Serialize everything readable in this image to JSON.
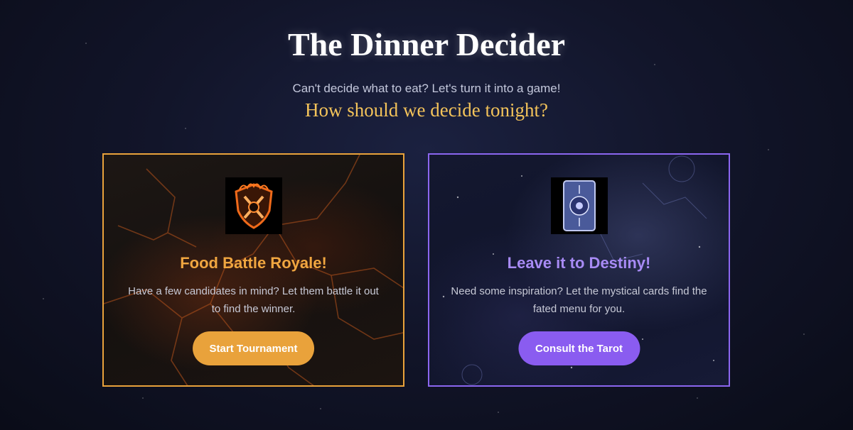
{
  "header": {
    "title": "The Dinner Decider",
    "subtitle": "Can't decide what to eat? Let's turn it into a game!",
    "question": "How should we decide tonight?"
  },
  "cards": [
    {
      "title": "Food Battle Royale!",
      "description": "Have a few candidates in mind? Let them battle it out to find the winner.",
      "button": "Start Tournament",
      "icon": "flaming-shield-icon",
      "accent": "#e9a23b"
    },
    {
      "title": "Leave it to Destiny!",
      "description": "Need some inspiration? Let the mystical cards find the fated menu for you.",
      "button": "Consult the Tarot",
      "icon": "tarot-card-icon",
      "accent": "#8a5cf0"
    }
  ],
  "colors": {
    "background": "#12152a",
    "question": "#f3c35a",
    "battle_title": "#f0a640",
    "destiny_title": "#a88bf5"
  }
}
